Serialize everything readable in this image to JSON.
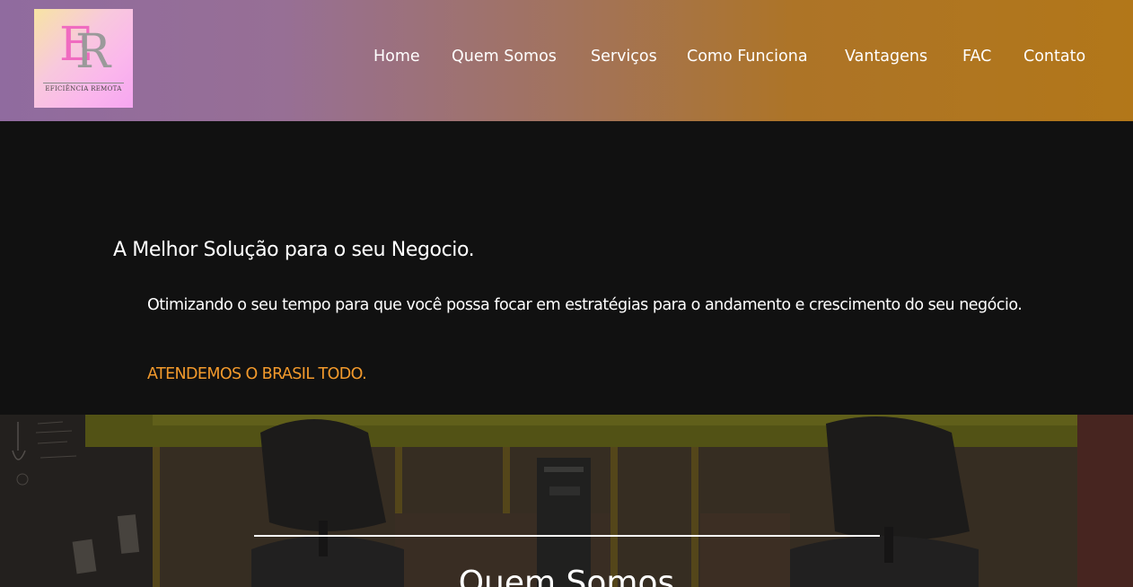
{
  "logo": {
    "letter_e": "E",
    "letter_r": "R",
    "caption": "EFICIÊNCIA REMOTA"
  },
  "nav": {
    "items": [
      {
        "label": "Home"
      },
      {
        "label": "Quem Somos"
      },
      {
        "label": "Serviços"
      },
      {
        "label": "Como Funciona"
      },
      {
        "label": "Vantagens"
      },
      {
        "label": "FAC"
      },
      {
        "label": "Contato"
      }
    ]
  },
  "hero": {
    "title": "A Melhor Solução para o seu Negocio.",
    "text": "Otimizando o seu tempo para que você possa focar em estratégias para o andamento e crescimento do seu negócio.",
    "highlight": "ATENDEMOS O BRASIL TODO."
  },
  "about": {
    "heading": "Quem Somos"
  },
  "colors": {
    "header_gradient_start": "#906b9f",
    "header_gradient_end": "#b27719",
    "hero_background": "#111111",
    "accent_orange": "#f39a2c",
    "logo_pink": "#f06bc0",
    "logo_gray": "#9a9a9a"
  }
}
